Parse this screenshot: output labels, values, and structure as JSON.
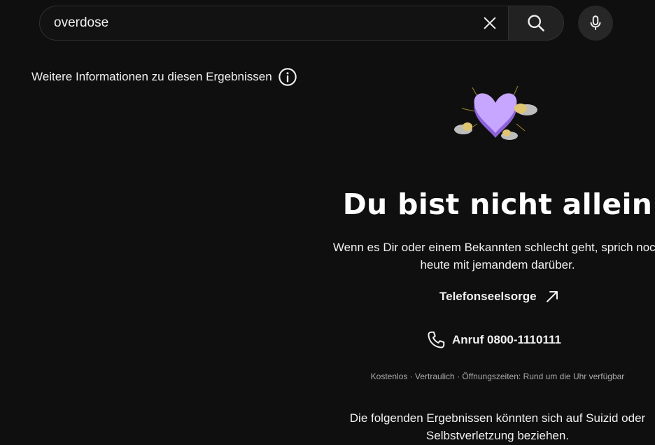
{
  "search": {
    "value": "overdose",
    "clear_icon": "close-icon",
    "search_icon": "search-icon",
    "mic_icon": "microphone-icon"
  },
  "info": {
    "label": "Weitere Informationen zu diesen Ergebnissen",
    "icon": "info-icon"
  },
  "crisis_panel": {
    "illustration": "heart-clouds-illustration",
    "title": "Du bist nicht allein",
    "message_line1": "Wenn es Dir oder einem Bekannten schlecht geht, sprich noch",
    "message_line2": "heute mit jemandem darüber.",
    "hotline_label": "Telefonseelsorge",
    "hotline_icon": "external-link-arrow-icon",
    "call_label": "Anruf 0800-1110111",
    "call_icon": "phone-icon",
    "availability": "Kostenlos · Vertraulich · Öffnungszeiten: Rund um die Uhr verfügbar",
    "disclaimer_line1": "Die folgenden Ergebnissen könnten sich auf Suizid oder",
    "disclaimer_line2": "Selbstverletzung beziehen."
  },
  "colors": {
    "background": "#0f0f0f",
    "text": "#f1f1f1",
    "muted": "#aaaaaa",
    "heart": "#b98cff"
  }
}
